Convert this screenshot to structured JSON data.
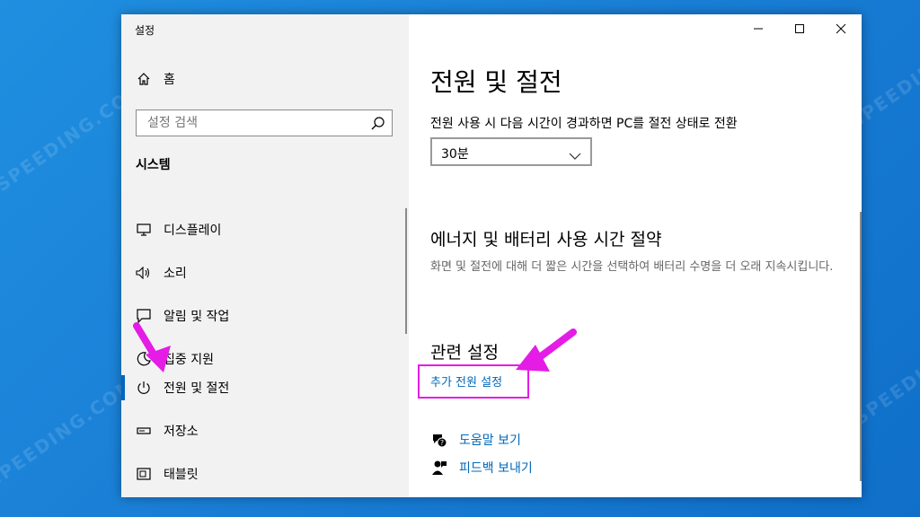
{
  "watermark": "SPEEDING.COM",
  "app": {
    "title": "설정"
  },
  "sidebar": {
    "home_label": "홈",
    "search_placeholder": "설정 검색",
    "section": "시스템",
    "items": [
      {
        "label": "디스플레이",
        "icon": "monitor-icon"
      },
      {
        "label": "소리",
        "icon": "speaker-icon"
      },
      {
        "label": "알림 및 작업",
        "icon": "notification-icon"
      },
      {
        "label": "집중 지원",
        "icon": "moon-icon"
      },
      {
        "label": "전원 및 절전",
        "icon": "power-icon",
        "active": true
      },
      {
        "label": "저장소",
        "icon": "storage-icon"
      },
      {
        "label": "태블릿",
        "icon": "tablet-icon"
      }
    ]
  },
  "content": {
    "title": "전원 및 절전",
    "screen_label": "전원 사용 시 다음 시간이 경과하면 PC를 절전 상태로 전환",
    "dropdown_value": "30분",
    "battery_heading": "에너지 및 배터리 사용 시간 절약",
    "battery_desc": "화면 및 절전에 대해 더 짧은 시간을 선택하여 배터리 수명을 더 오래 지속시킵니다.",
    "related_heading": "관련 설정",
    "additional_power_link": "추가 전원 설정",
    "help_link": "도움말 보기",
    "feedback_link": "피드백 보내기"
  },
  "colors": {
    "accent": "#0067b8",
    "highlight": "#e41ce6",
    "sidebar_bg": "#f2f2f2"
  }
}
